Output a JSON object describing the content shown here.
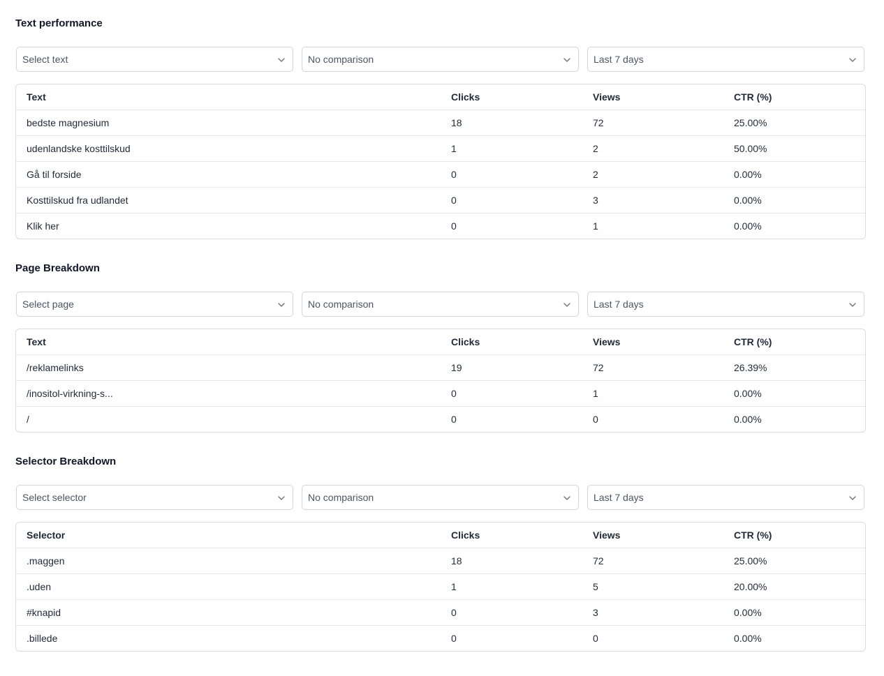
{
  "sections": [
    {
      "title": "Text performance",
      "filters": [
        "Select text",
        "No comparison",
        "Last 7 days"
      ],
      "columns": [
        "Text",
        "Clicks",
        "Views",
        "CTR (%)"
      ],
      "rows": [
        [
          "bedste magnesium",
          "18",
          "72",
          "25.00%"
        ],
        [
          "udenlandske kosttilskud",
          "1",
          "2",
          "50.00%"
        ],
        [
          "Gå til forside",
          "0",
          "2",
          "0.00%"
        ],
        [
          "Kosttilskud fra udlandet",
          "0",
          "3",
          "0.00%"
        ],
        [
          "Klik her",
          "0",
          "1",
          "0.00%"
        ]
      ]
    },
    {
      "title": "Page Breakdown",
      "filters": [
        "Select page",
        "No comparison",
        "Last 7 days"
      ],
      "columns": [
        "Text",
        "Clicks",
        "Views",
        "CTR (%)"
      ],
      "rows": [
        [
          "/reklamelinks",
          "19",
          "72",
          "26.39%"
        ],
        [
          "/inositol-virkning-s...",
          "0",
          "1",
          "0.00%"
        ],
        [
          "/",
          "0",
          "0",
          "0.00%"
        ]
      ]
    },
    {
      "title": "Selector Breakdown",
      "filters": [
        "Select selector",
        "No comparison",
        "Last 7 days"
      ],
      "columns": [
        "Selector",
        "Clicks",
        "Views",
        "CTR (%)"
      ],
      "rows": [
        [
          ".maggen",
          "18",
          "72",
          "25.00%"
        ],
        [
          ".uden",
          "1",
          "5",
          "20.00%"
        ],
        [
          "#knapid",
          "0",
          "3",
          "0.00%"
        ],
        [
          ".billede",
          "0",
          "0",
          "0.00%"
        ]
      ]
    }
  ]
}
